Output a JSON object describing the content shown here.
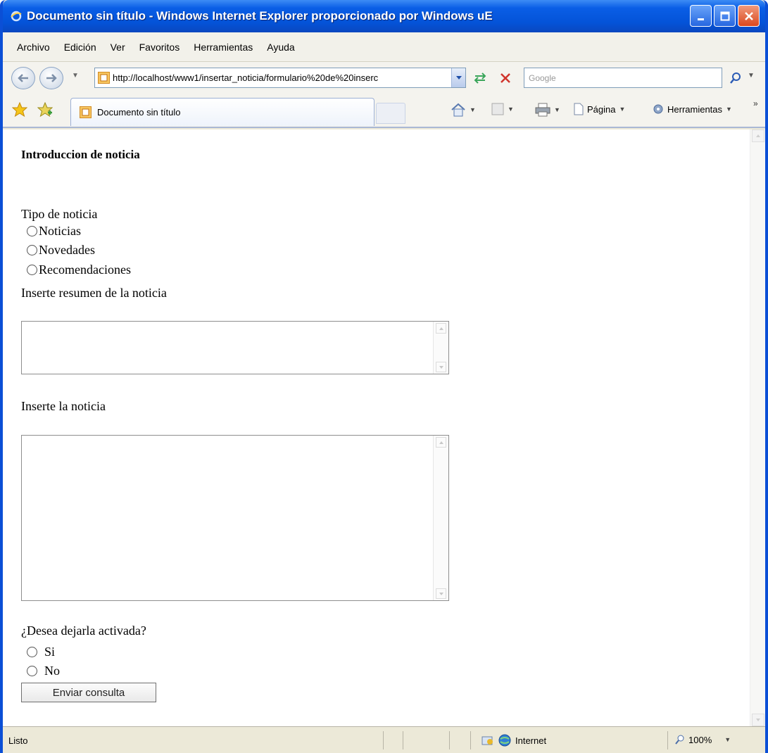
{
  "window": {
    "title": "Documento sin título - Windows Internet Explorer proporcionado por Windows uE"
  },
  "menubar": {
    "items": [
      {
        "label": "Archivo"
      },
      {
        "label": "Edición"
      },
      {
        "label": "Ver"
      },
      {
        "label": "Favoritos"
      },
      {
        "label": "Herramientas"
      },
      {
        "label": "Ayuda"
      }
    ]
  },
  "address": {
    "url": "http://localhost/www1/insertar_noticia/formulario%20de%20inserc",
    "search_placeholder": "Google"
  },
  "tabs": {
    "active_label": "Documento sin título"
  },
  "commandbar": {
    "page_label": "Página",
    "tools_label": "Herramientas",
    "overflow": "»"
  },
  "form": {
    "heading": "Introduccion de noticia",
    "type_label": "Tipo de noticia",
    "type_options": [
      "Noticias",
      "Novedades",
      "Recomendaciones"
    ],
    "summary_label": "Inserte resumen de la noticia",
    "news_label": "Inserte la noticia",
    "active_question": "¿Desea dejarla activada?",
    "active_options": [
      "Si",
      "No"
    ],
    "submit_label": "Enviar consulta"
  },
  "statusbar": {
    "status": "Listo",
    "zone": "Internet",
    "zoom": "100%"
  },
  "colors": {
    "titlebar": "#0453d8",
    "chrome": "#ece9d8"
  }
}
